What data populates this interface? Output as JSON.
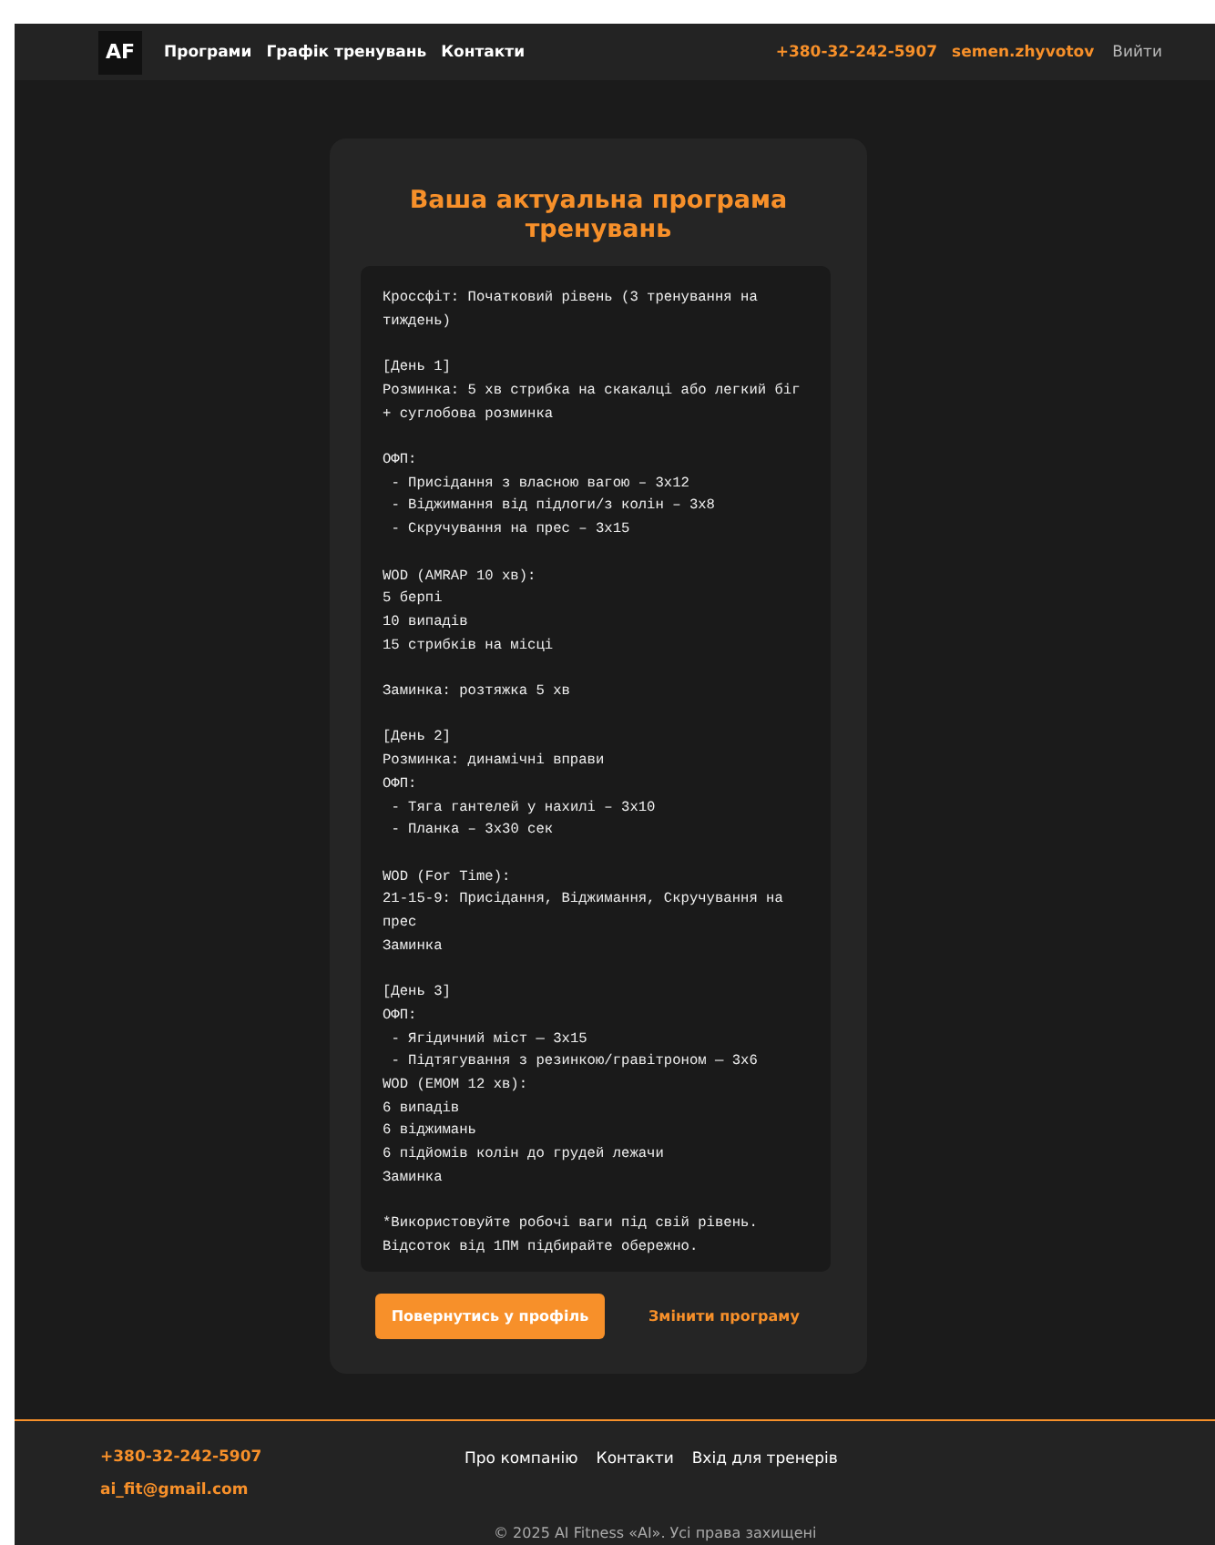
{
  "header": {
    "logo": "AF",
    "nav": [
      "Програми",
      "Графік тренувань",
      "Контакти"
    ],
    "phone": "+380-32-242-5907",
    "username": "semen.zhyvotov",
    "logout": "Вийти"
  },
  "card": {
    "title": "Ваша актуальна програма тренувань",
    "program_text": "Кроссфіт: Початковий рівень (3 тренування на тиждень)\n\n[День 1]\nРозминка: 5 хв стрибка на скакалці або легкий біг + суглобова розминка\n\nОФП:\n - Присідання з власною вагою – 3x12\n - Віджимання від підлоги/з колін – 3x8\n - Скручування на прес – 3x15\n\nWOD (AMRAP 10 хв):\n5 берпі\n10 випадів\n15 стрибків на місці\n\nЗаминка: розтяжка 5 хв\n\n[День 2]\nРозминка: динамічні вправи\nОФП:\n - Тяга гантелей у нахилі – 3x10\n - Планка – 3x30 сек\n\nWOD (For Time):\n21-15-9: Присідання, Віджимання, Скручування на прес\nЗаминка\n\n[День 3]\nОФП:\n - Ягідичний міст — 3x15\n - Підтягування з резинкою/гравітроном — 3x6\nWOD (EMOM 12 хв):\n6 випадів\n6 віджимань\n6 підйомів колін до грудей лежачи\nЗаминка\n\n*Використовуйте робочі ваги під свій рівень.\nВідсоток від 1ПМ підбирайте обережно.",
    "primary_button": "Повернутись у профіль",
    "secondary_link": "Змінити програму"
  },
  "footer": {
    "phone": "+380-32-242-5907",
    "email": "ai_fit@gmail.com",
    "links": [
      "Про компанію",
      "Контакти",
      "Вхід для тренерів"
    ],
    "copyright": "© 2025 AI Fitness «AI». Усі права захищені"
  }
}
